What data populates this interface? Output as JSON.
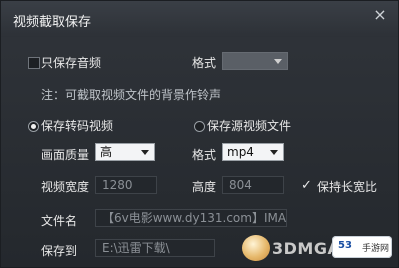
{
  "window": {
    "title": "视频截取保存",
    "close_icon": "close-icon"
  },
  "audio_only": {
    "label": "只保存音频",
    "format_label": "格式",
    "format_value": "",
    "note": "注：可截取视频文件的背景作铃声"
  },
  "convert": {
    "label": "保存转码视频",
    "original_label": "保存源视频文件"
  },
  "quality": {
    "label": "画面质量",
    "value": "高"
  },
  "format": {
    "label": "格式",
    "value": "mp4"
  },
  "size": {
    "width_label": "视频宽度",
    "width_value": "1280",
    "height_label": "高度",
    "height_value": "804",
    "keep_ratio_label": "保持长宽比"
  },
  "filename": {
    "label": "文件名",
    "value": "【6v电影www.dy131.com】IMA"
  },
  "saveto": {
    "label": "保存到",
    "value": "E:\\迅雷下载\\"
  },
  "watermark": {
    "text": "3DMGAME",
    "badge_left": "53",
    "badge_right": "手游网"
  }
}
